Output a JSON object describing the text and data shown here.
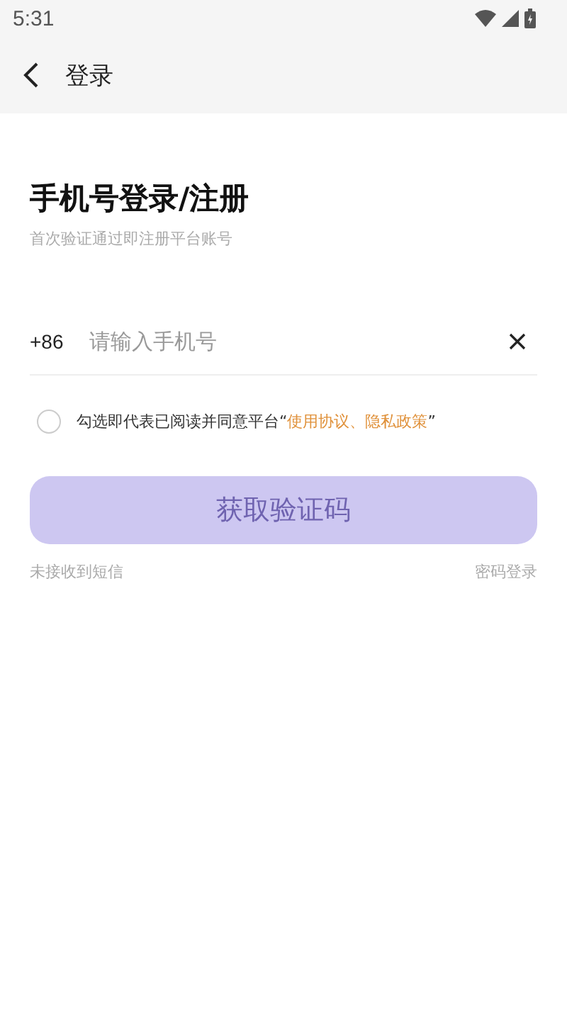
{
  "status_bar": {
    "time": "5:31"
  },
  "header": {
    "title": "登录"
  },
  "heading": "手机号登录/注册",
  "subheading": "首次验证通过即注册平台账号",
  "phone_field": {
    "prefix": "+86",
    "placeholder": "请输入手机号"
  },
  "agreement": {
    "checked": false,
    "text": "勾选即代表已阅读并同意平台",
    "open_quote": "“",
    "links": [
      "使用协议",
      "隐私政策"
    ],
    "separator": "、",
    "close_quote": "”"
  },
  "submit_button": {
    "label": "获取验证码",
    "disabled": true
  },
  "footer_links": [
    "未接收到短信",
    "密码登录"
  ]
}
